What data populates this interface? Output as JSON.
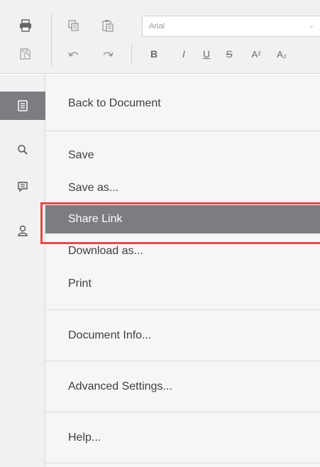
{
  "toolbar": {
    "font_name": "Arial",
    "font_dropdown_arrow": "⌄",
    "format": {
      "bold": "B",
      "italic": "I",
      "underline": "U",
      "strikethrough": "S",
      "superscript": "A²",
      "subscript": "A₂"
    },
    "icons": [
      "print-icon",
      "copy-icon",
      "paste-icon",
      "save-icon",
      "undo-icon",
      "redo-icon"
    ]
  },
  "rail": {
    "items": [
      {
        "icon": "document-icon",
        "active": true
      },
      {
        "icon": "search-icon",
        "active": false
      },
      {
        "icon": "comment-icon",
        "active": false
      },
      {
        "icon": "user-icon",
        "active": false
      }
    ]
  },
  "menu": {
    "back": "Back to Document",
    "save": "Save",
    "save_as": "Save as...",
    "share_link": "Share Link",
    "download_as": "Download as...",
    "print": "Print",
    "document_info": "Document Info...",
    "advanced_settings": "Advanced Settings...",
    "help": "Help...",
    "selected": "Share Link"
  },
  "colors": {
    "selected_bg": "#7b7d80",
    "highlight_border": "#e24a4a",
    "panel_bg": "#f1f1f1",
    "menu_bg": "#f6f6f6"
  }
}
